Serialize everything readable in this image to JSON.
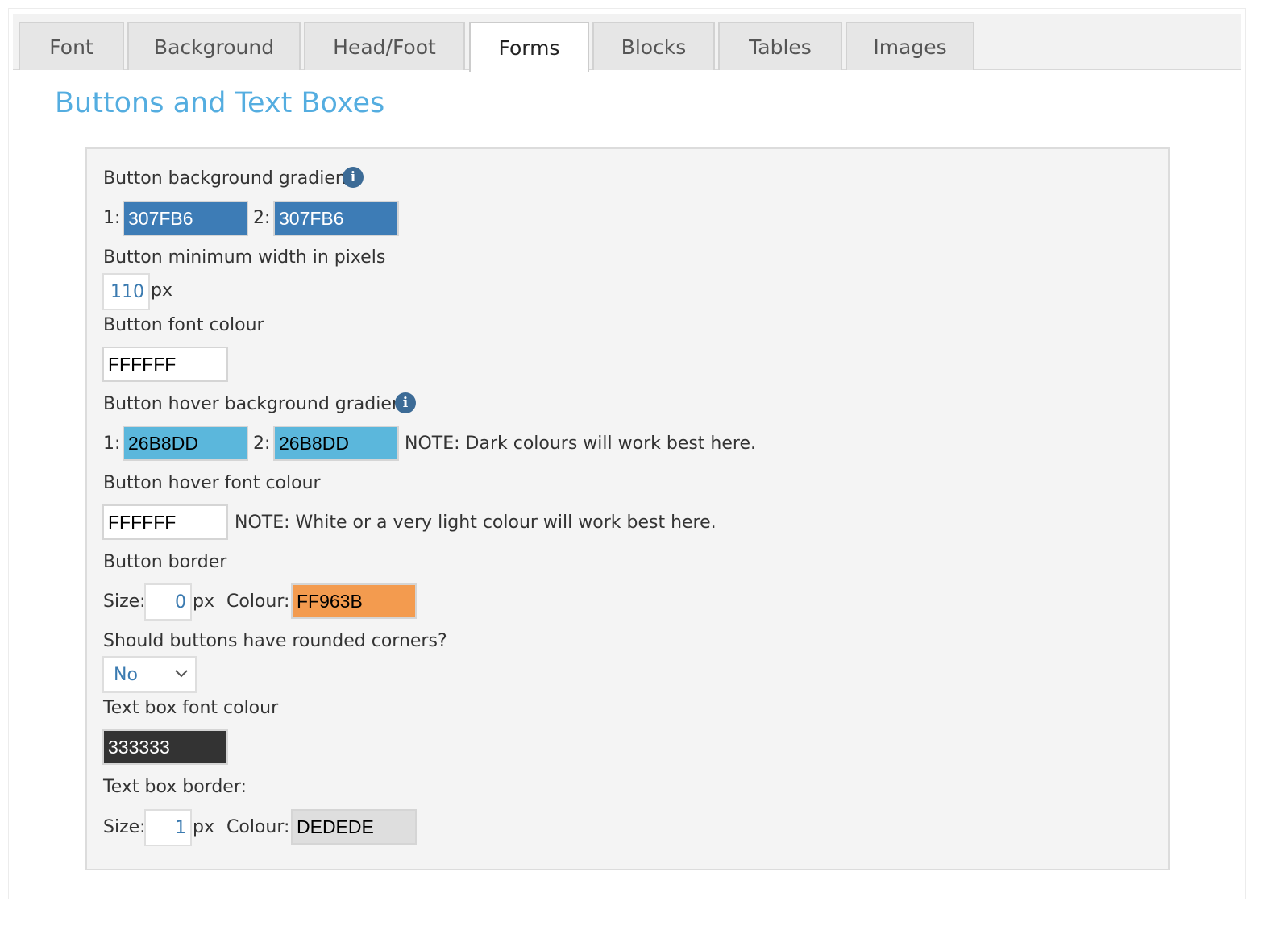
{
  "tabs": [
    {
      "label": "Font",
      "active": false
    },
    {
      "label": "Background",
      "active": false
    },
    {
      "label": "Head/Foot",
      "active": false
    },
    {
      "label": "Forms",
      "active": true
    },
    {
      "label": "Blocks",
      "active": false
    },
    {
      "label": "Tables",
      "active": false
    },
    {
      "label": "Images",
      "active": false
    }
  ],
  "section_title": "Buttons and Text Boxes",
  "info_glyph": "i",
  "fields": {
    "btn_bg_gradient": {
      "label": "Button background gradient",
      "prefix1": "1:",
      "value1": "307FB6",
      "color1": "#3d7cb6",
      "prefix2": "2:",
      "value2": "307FB6",
      "color2": "#3d7cb6"
    },
    "btn_min_width": {
      "label": "Button minimum width in pixels",
      "value": "110",
      "unit": "px"
    },
    "btn_font_colour": {
      "label": "Button font colour",
      "value": "FFFFFF",
      "color": "#ffffff"
    },
    "btn_hover_gradient": {
      "label": "Button hover background gradient",
      "prefix1": "1:",
      "value1": "26B8DD",
      "color1": "#5bb7dc",
      "prefix2": "2:",
      "value2": "26B8DD",
      "color2": "#5bb7dc",
      "note": "NOTE: Dark colours will work best here."
    },
    "btn_hover_font_colour": {
      "label": "Button hover font colour",
      "value": "FFFFFF",
      "color": "#ffffff",
      "note": "NOTE: White or a very light colour will work best here."
    },
    "btn_border": {
      "label": "Button border",
      "size_label": "Size:",
      "size": "0",
      "unit": "px",
      "colour_label": "Colour:",
      "colour": "FF963B",
      "color": "#f39b4f"
    },
    "rounded_corners": {
      "label": "Should buttons have rounded corners?",
      "selected": "No"
    },
    "textbox_font_colour": {
      "label": "Text box font colour",
      "value": "333333",
      "color": "#333333"
    },
    "textbox_border": {
      "label": "Text box border:",
      "size_label": "Size:",
      "size": "1",
      "unit": "px",
      "colour_label": "Colour:",
      "colour": "DEDEDE",
      "color": "#dedede"
    }
  }
}
